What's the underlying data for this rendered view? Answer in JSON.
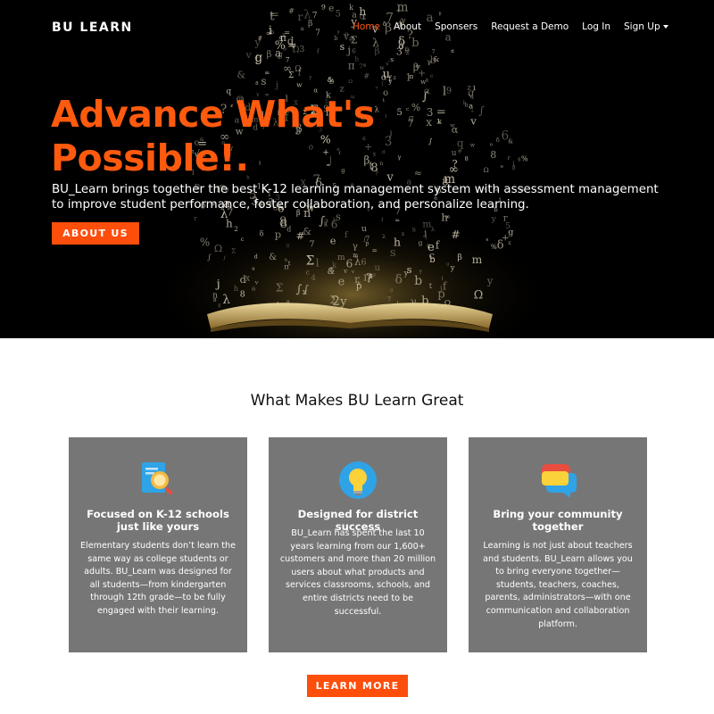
{
  "header": {
    "brand": "BU LEARN",
    "nav": [
      {
        "label": "Home",
        "active": true
      },
      {
        "label": "About",
        "active": false
      },
      {
        "label": "Sponsers",
        "active": false
      },
      {
        "label": "Request a Demo",
        "active": false
      },
      {
        "label": "Log In",
        "active": false
      },
      {
        "label": "Sign Up",
        "active": false,
        "has_dropdown": true
      }
    ]
  },
  "hero": {
    "title_line1": "Advance What's",
    "title_line2": "Possible!.",
    "subtitle": "BU_Learn brings together the best K-12 learning management system with assessment management to improve student performance, foster collaboration, and personalize learning.",
    "cta_label": "ABOUT US"
  },
  "features": {
    "title": "What Makes BU Learn Great",
    "cards": [
      {
        "icon": "magnifier-document-icon",
        "title": "Focused on K-12 schools just like yours",
        "text": "Elementary students don’t learn the same way as college students or adults. BU_Learn was designed for all students—from kindergarten through 12th grade—to be fully engaged with their learning."
      },
      {
        "icon": "lightbulb-icon",
        "title": "Designed for district success",
        "text": "BU_Learn has spent the last 10 years learning from our 1,600+ customers and more than 20 million users about what products and services classrooms, schools, and entire districts need to be successful."
      },
      {
        "icon": "chat-bubbles-icon",
        "title": "Bring your community together",
        "text": "Learning is not just about teachers and students. BU_Learn allows you to bring everyone together—students, teachers, coaches, parents, administrators—with one communication and collaboration platform."
      }
    ],
    "cta_label": "LEARN MORE"
  },
  "colors": {
    "accent": "#fd4e0c",
    "card_bg": "#767676",
    "hero_bg": "#000000"
  }
}
